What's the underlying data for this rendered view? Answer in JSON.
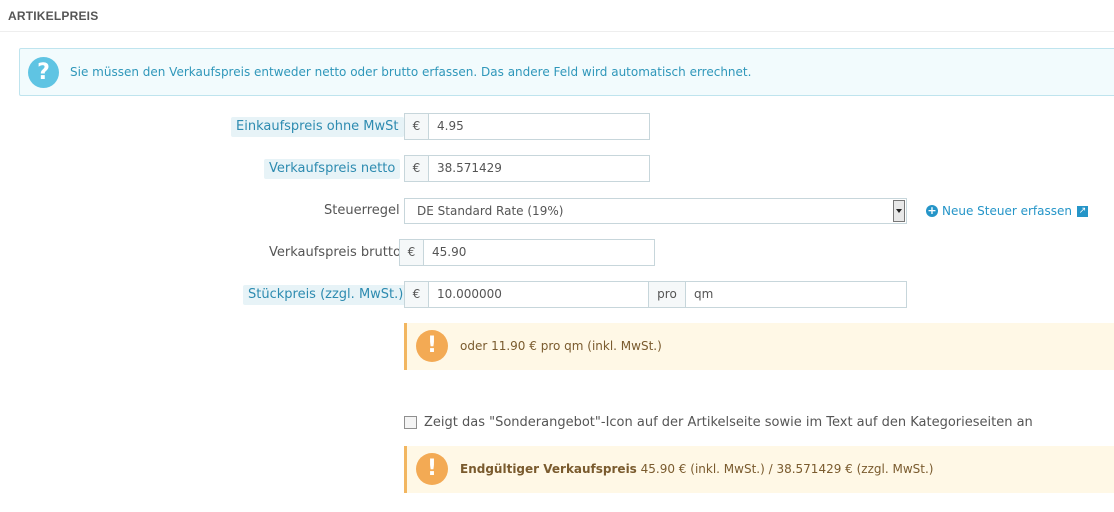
{
  "panel": {
    "title": "ARTIKELPREIS"
  },
  "info_alert": {
    "icon": "question-circle-icon",
    "text": "Sie müssen den Verkaufspreis entweder netto oder brutto erfassen. Das andere Feld wird automatisch errechnet."
  },
  "fields": {
    "wholesale": {
      "label": "Einkaufspreis ohne MwSt",
      "currency": "€",
      "value": "4.95"
    },
    "price_net": {
      "label": "Verkaufspreis netto",
      "currency": "€",
      "value": "38.571429"
    },
    "tax_rule": {
      "label": "Steuerregel",
      "selected": "DE Standard Rate (19%)",
      "new_tax_link": "Neue Steuer erfassen"
    },
    "price_gross": {
      "label": "Verkaufspreis brutto",
      "currency": "€",
      "value": "45.90"
    },
    "unit_price": {
      "label": "Stückpreis (zzgl. MwSt.)",
      "currency": "€",
      "value": "10.000000",
      "per_label": "pro",
      "unit": "qm"
    }
  },
  "unit_price_alert": {
    "icon": "exclamation-icon",
    "text": "oder 11.90 € pro qm (inkl. MwSt.)"
  },
  "on_sale": {
    "checked": false,
    "label": "Zeigt das \"Sonderangebot\"-Icon auf der Artikelseite sowie im Text auf den Kategorieseiten an"
  },
  "final_price_alert": {
    "icon": "exclamation-icon",
    "title": "Endgültiger Verkaufspreis",
    "text": " 45.90 € (inkl. MwSt.) / 38.571429 € (zzgl. MwSt.)"
  },
  "colors": {
    "info_text": "#2f97ba",
    "info_icon": "#5fc4e3",
    "warning_icon": "#f3aa54",
    "warning_bg": "#fff8e6",
    "link": "#2595c8"
  }
}
